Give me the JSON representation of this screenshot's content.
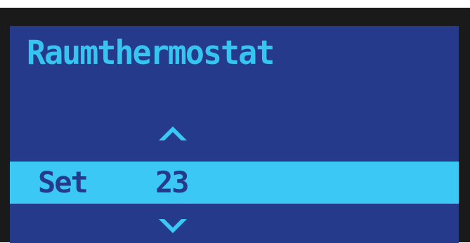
{
  "screen": {
    "title": "Raumthermostat",
    "setting": {
      "label": "Set",
      "value": "23"
    },
    "controls": {
      "increase_icon": "chevron-up-icon",
      "decrease_icon": "chevron-down-icon"
    }
  },
  "colors": {
    "bezel": "#1a1a1a",
    "screen_background": "#253a8a",
    "accent": "#3bc8f4"
  }
}
